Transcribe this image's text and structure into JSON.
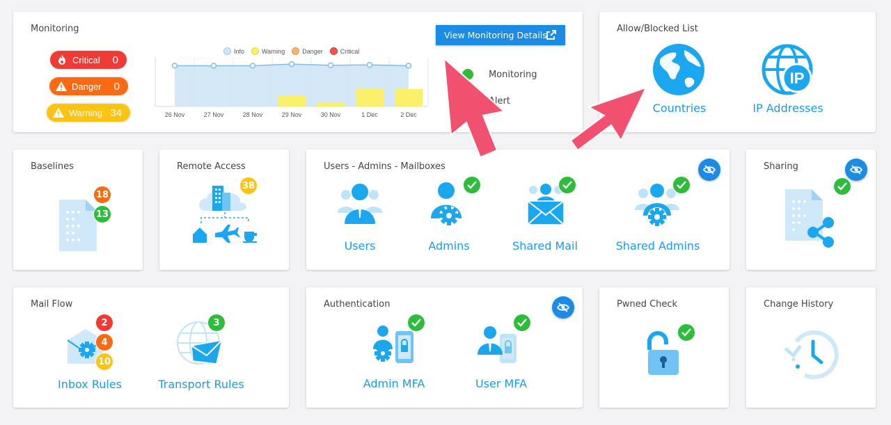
{
  "monitoring": {
    "title": "Monitoring",
    "details_button": "View Monitoring Details",
    "pills": [
      {
        "label": "Critical",
        "count": "0",
        "color": "#f03a36"
      },
      {
        "label": "Danger",
        "count": "0",
        "color": "#fb6a10"
      },
      {
        "label": "Warning",
        "count": "34",
        "color": "#fcc310"
      }
    ],
    "status": [
      {
        "label": "Monitoring",
        "color": "#2ebd3a"
      },
      {
        "label": "Alert",
        "color": "#aaaaaa"
      }
    ]
  },
  "chart_data": {
    "type": "bar",
    "categories": [
      "26 Nov",
      "27 Nov",
      "28 Nov",
      "29 Nov",
      "30 Nov",
      "1 Dec",
      "2 Dec"
    ],
    "series": [
      {
        "name": "Info",
        "type": "line",
        "color": "#7fbde9",
        "values": [
          100,
          100,
          100,
          104,
          101,
          102,
          100
        ]
      },
      {
        "name": "Warning",
        "type": "bar",
        "color": "#fbf06a",
        "values": [
          0,
          0,
          0,
          3,
          1,
          5,
          5
        ]
      },
      {
        "name": "Danger",
        "color": "#f5b570",
        "values": [
          0,
          0,
          0,
          0,
          0,
          0,
          0
        ]
      },
      {
        "name": "Critical",
        "color": "#f0544c",
        "values": [
          0,
          0,
          0,
          0,
          0,
          0,
          0
        ]
      }
    ],
    "legend_position": "top",
    "grid": "vertical"
  },
  "allow_blocked": {
    "title": "Allow/Blocked List",
    "tiles": [
      {
        "label": "Countries"
      },
      {
        "label": "IP Addresses"
      }
    ]
  },
  "baselines": {
    "title": "Baselines",
    "badges": [
      "18",
      "13"
    ]
  },
  "remote_access": {
    "title": "Remote Access",
    "badge": "38"
  },
  "users_admins": {
    "title": "Users - Admins - Mailboxes",
    "tiles": [
      {
        "label": "Users"
      },
      {
        "label": "Admins"
      },
      {
        "label": "Shared Mail"
      },
      {
        "label": "Shared Admins"
      }
    ]
  },
  "sharing": {
    "title": "Sharing"
  },
  "mail_flow": {
    "title": "Mail Flow",
    "inbox_badges": [
      "2",
      "4",
      "10"
    ],
    "transport_badge": "3",
    "tiles": [
      {
        "label": "Inbox Rules"
      },
      {
        "label": "Transport Rules"
      }
    ]
  },
  "authentication": {
    "title": "Authentication",
    "tiles": [
      {
        "label": "Admin MFA"
      },
      {
        "label": "User MFA"
      }
    ]
  },
  "pwned": {
    "title": "Pwned Check"
  },
  "change_history": {
    "title": "Change History"
  },
  "colors": {
    "accent": "#1a8ce6",
    "icon_blue": "#1aa7f0",
    "icon_light": "#bfe3f8",
    "check_green": "#2ebd3a",
    "arrow_pink": "#f2506f"
  }
}
